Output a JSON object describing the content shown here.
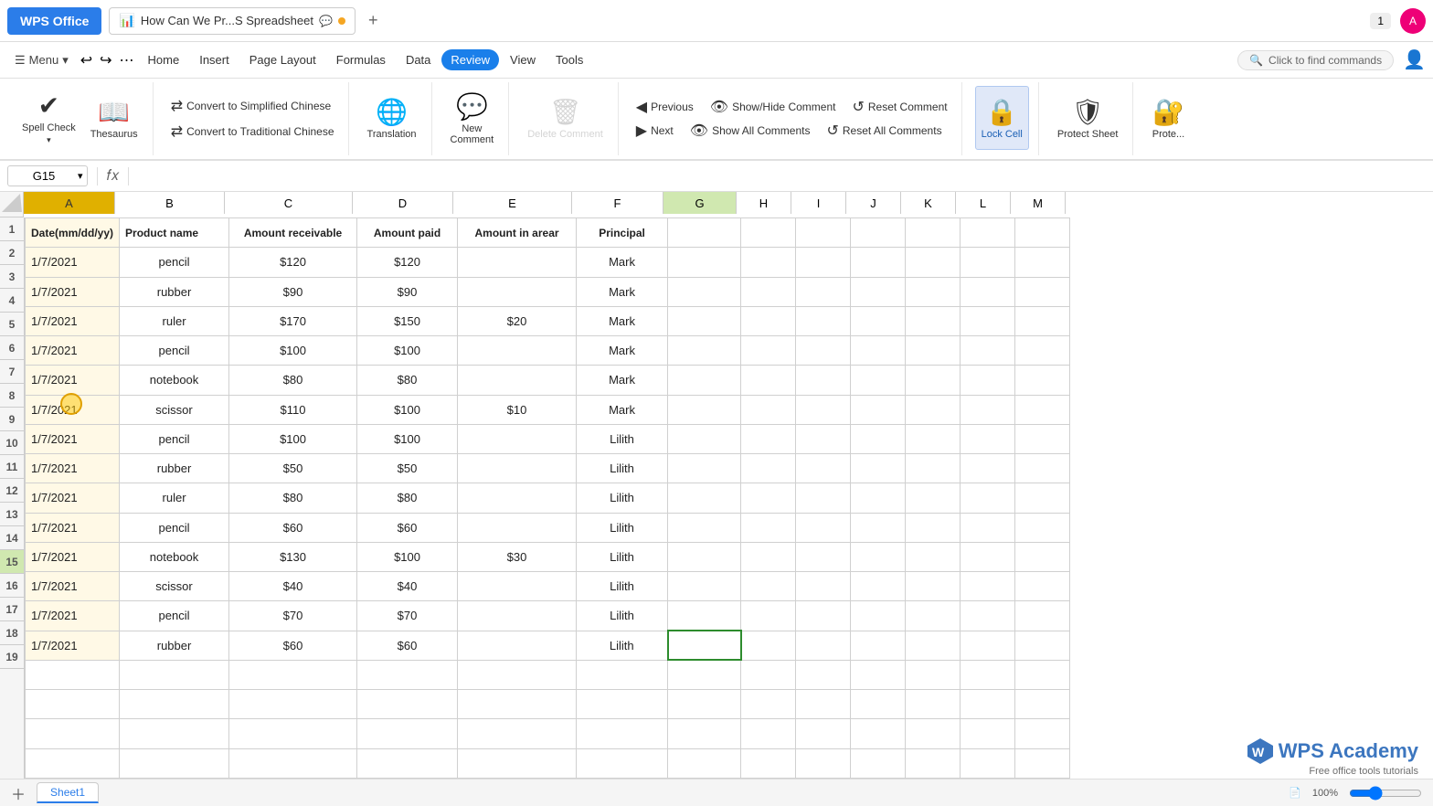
{
  "titleBar": {
    "wpsLabel": "WPS Office",
    "tabLabel": "How Can We Pr...S Spreadsheet",
    "newTabLabel": "+"
  },
  "menuBar": {
    "menuToggle": "☰  Menu",
    "items": [
      {
        "label": "Home",
        "active": false
      },
      {
        "label": "Insert",
        "active": false
      },
      {
        "label": "Page Layout",
        "active": false
      },
      {
        "label": "Formulas",
        "active": false
      },
      {
        "label": "Data",
        "active": false
      },
      {
        "label": "Review",
        "active": true
      },
      {
        "label": "View",
        "active": false
      },
      {
        "label": "Tools",
        "active": false
      }
    ],
    "searchLabel": "Click to find commands"
  },
  "ribbon": {
    "spellCheckLabel": "Spell Check",
    "thesaurusLabel": "Thesaurus",
    "convertSimplifiedLabel": "Convert to Simplified Chinese",
    "convertTraditionalLabel": "Convert to Traditional Chinese",
    "translationLabel": "Translation",
    "newCommentLabel": "New Comment",
    "deleteCommentLabel": "Delete Comment",
    "previousLabel": "Previous",
    "nextLabel": "Next",
    "showHideCommentLabel": "Show/Hide Comment",
    "showAllCommentsLabel": "Show All Comments",
    "resetCommentLabel": "Reset Comment",
    "resetAllCommentsLabel": "Reset All Comments",
    "lockCellLabel": "Lock Cell",
    "protectSheetLabel": "Protect Sheet",
    "protectLabel": "Prote..."
  },
  "formulaBar": {
    "cellRef": "G15",
    "formula": ""
  },
  "columns": [
    "A",
    "B",
    "C",
    "D",
    "E",
    "F",
    "G",
    "H",
    "I",
    "J",
    "K",
    "L",
    "M"
  ],
  "rows": [
    1,
    2,
    3,
    4,
    5,
    6,
    7,
    8,
    9,
    10,
    11,
    12,
    13,
    14,
    15,
    16,
    17,
    18,
    19
  ],
  "headers": {
    "A": "Date(mm/dd/yy)",
    "B": "Product name",
    "C": "Amount receivable",
    "D": "Amount paid",
    "E": "Amount in arear",
    "F": "Principal"
  },
  "tableData": [
    {
      "row": 2,
      "A": "1/7/2021",
      "B": "pencil",
      "C": "$120",
      "D": "$120",
      "E": "",
      "F": "Mark"
    },
    {
      "row": 3,
      "A": "1/7/2021",
      "B": "rubber",
      "C": "$90",
      "D": "$90",
      "E": "",
      "F": "Mark"
    },
    {
      "row": 4,
      "A": "1/7/2021",
      "B": "ruler",
      "C": "$170",
      "D": "$150",
      "E": "$20",
      "F": "Mark"
    },
    {
      "row": 5,
      "A": "1/7/2021",
      "B": "pencil",
      "C": "$100",
      "D": "$100",
      "E": "",
      "F": "Mark"
    },
    {
      "row": 6,
      "A": "1/7/2021",
      "B": "notebook",
      "C": "$80",
      "D": "$80",
      "E": "",
      "F": "Mark"
    },
    {
      "row": 7,
      "A": "1/7/2021",
      "B": "scissor",
      "C": "$110",
      "D": "$100",
      "E": "$10",
      "F": "Mark"
    },
    {
      "row": 8,
      "A": "1/7/2021",
      "B": "pencil",
      "C": "$100",
      "D": "$100",
      "E": "",
      "F": "Lilith"
    },
    {
      "row": 9,
      "A": "1/7/2021",
      "B": "rubber",
      "C": "$50",
      "D": "$50",
      "E": "",
      "F": "Lilith"
    },
    {
      "row": 10,
      "A": "1/7/2021",
      "B": "ruler",
      "C": "$80",
      "D": "$80",
      "E": "",
      "F": "Lilith"
    },
    {
      "row": 11,
      "A": "1/7/2021",
      "B": "pencil",
      "C": "$60",
      "D": "$60",
      "E": "",
      "F": "Lilith"
    },
    {
      "row": 12,
      "A": "1/7/2021",
      "B": "notebook",
      "C": "$130",
      "D": "$100",
      "E": "$30",
      "F": "Lilith"
    },
    {
      "row": 13,
      "A": "1/7/2021",
      "B": "scissor",
      "C": "$40",
      "D": "$40",
      "E": "",
      "F": "Lilith"
    },
    {
      "row": 14,
      "A": "1/7/2021",
      "B": "pencil",
      "C": "$70",
      "D": "$70",
      "E": "",
      "F": "Lilith"
    },
    {
      "row": 15,
      "A": "1/7/2021",
      "B": "rubber",
      "C": "$60",
      "D": "$60",
      "E": "",
      "F": "Lilith"
    }
  ],
  "statusBar": {
    "sheetName": "Sheet1"
  },
  "watermark": {
    "line1": "WPS Academy",
    "line2": "Free office tools tutorials"
  }
}
